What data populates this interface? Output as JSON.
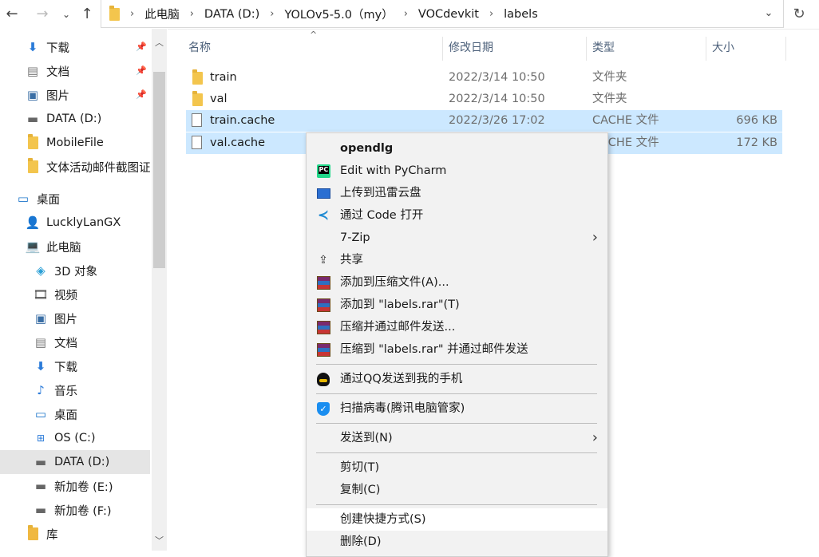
{
  "address": {
    "crumbs": [
      "此电脑",
      "DATA (D:)",
      "YOLOv5-5.0（my）",
      "VOCdevkit",
      "labels"
    ]
  },
  "nav": {
    "quick_access": [
      {
        "label": "下载",
        "icon": "download-arrow-icon",
        "pinned": true
      },
      {
        "label": "文档",
        "icon": "document-icon",
        "pinned": true
      },
      {
        "label": "图片",
        "icon": "picture-icon",
        "pinned": true
      },
      {
        "label": "DATA (D:)",
        "icon": "drive-icon"
      },
      {
        "label": "MobileFile",
        "icon": "folder-icon"
      },
      {
        "label": "文体活动邮件截图证",
        "icon": "folder-icon"
      }
    ],
    "desktop": "桌面",
    "user": "LucklyLanGX",
    "this_pc": "此电脑",
    "pc_items": [
      "3D 对象",
      "视频",
      "图片",
      "文档",
      "下载",
      "音乐",
      "桌面",
      "OS (C:)",
      "DATA (D:)",
      "新加卷 (E:)",
      "新加卷 (F:)"
    ],
    "library": "库",
    "selected": "DATA (D:)"
  },
  "columns": {
    "name": "名称",
    "date": "修改日期",
    "type": "类型",
    "size": "大小"
  },
  "files": [
    {
      "name": "train",
      "date": "2022/3/14 10:50",
      "type": "文件夹",
      "size": "",
      "kind": "folder",
      "selected": false
    },
    {
      "name": "val",
      "date": "2022/3/14 10:50",
      "type": "文件夹",
      "size": "",
      "kind": "folder",
      "selected": false
    },
    {
      "name": "train.cache",
      "date": "2022/3/26 17:02",
      "type": "CACHE 文件",
      "size": "696 KB",
      "kind": "file",
      "selected": true
    },
    {
      "name": "val.cache",
      "date": "",
      "type": "CACHE 文件",
      "size": "172 KB",
      "kind": "file",
      "selected": true
    }
  ],
  "context_menu": {
    "items": [
      {
        "label": "opendlg",
        "bold": true,
        "icon": ""
      },
      {
        "label": "Edit with PyCharm",
        "icon": "pycharm-icon"
      },
      {
        "label": "上传到迅雷云盘",
        "icon": "xunlei-cloud-icon"
      },
      {
        "label": "通过 Code 打开",
        "icon": "vscode-icon"
      },
      {
        "label": "7-Zip",
        "icon": "",
        "submenu": true
      },
      {
        "label": "共享",
        "icon": "share-icon"
      },
      {
        "label": "添加到压缩文件(A)...",
        "icon": "winrar-icon"
      },
      {
        "label": "添加到 \"labels.rar\"(T)",
        "icon": "winrar-icon"
      },
      {
        "label": "压缩并通过邮件发送...",
        "icon": "winrar-icon"
      },
      {
        "label": "压缩到 \"labels.rar\" 并通过邮件发送",
        "icon": "winrar-icon"
      },
      {
        "label": "通过QQ发送到我的手机",
        "icon": "qq-icon"
      },
      {
        "label": "扫描病毒(腾讯电脑管家)",
        "icon": "tencent-shield-icon"
      },
      {
        "label": "发送到(N)",
        "icon": "",
        "submenu": true
      },
      {
        "label": "剪切(T)",
        "icon": ""
      },
      {
        "label": "复制(C)",
        "icon": ""
      },
      {
        "label": "创建快捷方式(S)",
        "icon": "",
        "highlighted": true
      },
      {
        "label": "删除(D)",
        "icon": ""
      }
    ]
  }
}
